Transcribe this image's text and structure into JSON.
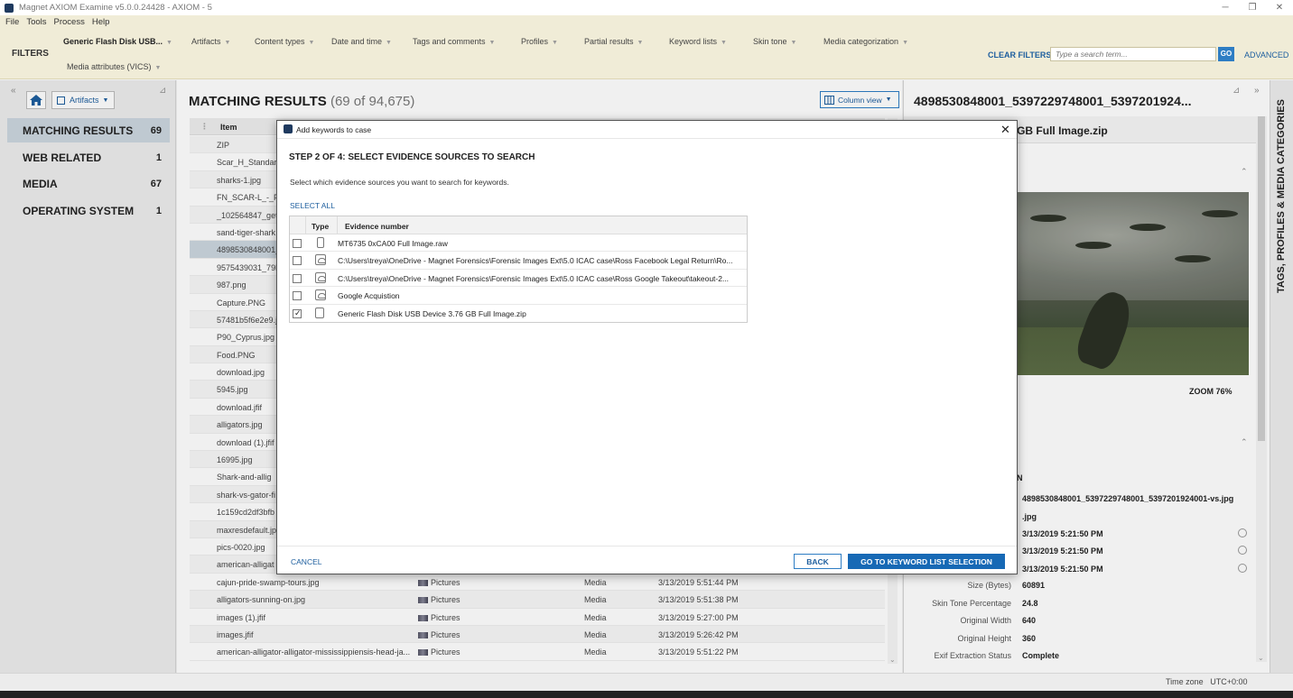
{
  "window": {
    "title": "Magnet AXIOM Examine v5.0.0.24428 - AXIOM - 5",
    "minimize": "─",
    "restore": "❐",
    "close": "✕"
  },
  "menu": [
    "File",
    "Tools",
    "Process",
    "Help"
  ],
  "filters": {
    "label": "FILTERS",
    "items": [
      "Generic Flash Disk USB...",
      "Artifacts",
      "Content types",
      "Date and time",
      "Tags and comments",
      "Profiles",
      "Partial results",
      "Keyword lists",
      "Skin tone",
      "Media categorization"
    ],
    "row2": "Media attributes (VICS)",
    "clear": "CLEAR FILTERS",
    "search_placeholder": "Type a search term...",
    "go": "GO",
    "advanced": "ADVANCED"
  },
  "left": {
    "collapse": "«",
    "pin": "⊿",
    "artifacts_button": "Artifacts",
    "nav": [
      {
        "label": "MATCHING RESULTS",
        "count": "69"
      },
      {
        "label": "WEB RELATED",
        "count": "1"
      },
      {
        "label": "MEDIA",
        "count": "67"
      },
      {
        "label": "OPERATING SYSTEM",
        "count": "1"
      }
    ]
  },
  "center": {
    "title": "MATCHING RESULTS",
    "count": "(69 of 94,675)",
    "column_view": "Column view",
    "header_item": "Item",
    "rows": [
      {
        "name": "ZIP"
      },
      {
        "name": "Scar_H_Standard"
      },
      {
        "name": "sharks-1.jpg"
      },
      {
        "name": "FN_SCAR-L_-_FN"
      },
      {
        "name": "_102564847_gett"
      },
      {
        "name": "sand-tiger-shark"
      },
      {
        "name": "4898530848001_"
      },
      {
        "name": "9575439031_79b"
      },
      {
        "name": "987.png"
      },
      {
        "name": "Capture.PNG"
      },
      {
        "name": "57481b5f6e2e9.j"
      },
      {
        "name": "P90_Cyprus.jpg"
      },
      {
        "name": "Food.PNG"
      },
      {
        "name": "download.jpg"
      },
      {
        "name": "5945.jpg"
      },
      {
        "name": "download.jfif"
      },
      {
        "name": "alligators.jpg"
      },
      {
        "name": "download (1).jfif"
      },
      {
        "name": "16995.jpg"
      },
      {
        "name": "Shark-and-allig"
      },
      {
        "name": "shark-vs-gator-fi"
      },
      {
        "name": "1c159cd2df3bfb"
      },
      {
        "name": "maxresdefault.jp"
      },
      {
        "name": "pics-0020.jpg"
      },
      {
        "name": "american-alligat"
      },
      {
        "name": "cajun-pride-swamp-tours.jpg",
        "cat": "Pictures",
        "type": "Media",
        "date": "3/13/2019 5:51:44 PM"
      },
      {
        "name": "alligators-sunning-on.jpg",
        "cat": "Pictures",
        "type": "Media",
        "date": "3/13/2019 5:51:38 PM"
      },
      {
        "name": "images (1).jfif",
        "cat": "Pictures",
        "type": "Media",
        "date": "3/13/2019 5:27:00 PM"
      },
      {
        "name": "images.jfif",
        "cat": "Pictures",
        "type": "Media",
        "date": "3/13/2019 5:26:42 PM"
      },
      {
        "name": "american-alligator-alligator-mississippiensis-head-ja...",
        "cat": "Pictures",
        "type": "Media",
        "date": "3/13/2019 5:51:22 PM"
      }
    ]
  },
  "right": {
    "title": "4898530848001_5397229748001_5397201924...",
    "pin": "⊿",
    "collapse": "»",
    "sub": "sk USB Device 3.76 GB Full Image.zip",
    "zoom": "ZOOM 76%",
    "partial_label": "N",
    "values": [
      "4898530848001_5397229748001_5397201924001-vs.jpg",
      ".jpg",
      "3/13/2019 5:21:50 PM",
      "3/13/2019 5:21:50 PM",
      "3/13/2019 5:21:50 PM"
    ],
    "props": [
      {
        "k": "Size (Bytes)",
        "v": "60891"
      },
      {
        "k": "Skin Tone Percentage",
        "v": "24.8"
      },
      {
        "k": "Original Width",
        "v": "640"
      },
      {
        "k": "Original Height",
        "v": "360"
      },
      {
        "k": "Exif Extraction Status",
        "v": "Complete"
      }
    ]
  },
  "sidetab": "TAGS, PROFILES & MEDIA CATEGORIES",
  "status": {
    "timezone_label": "Time zone",
    "timezone_value": "UTC+0:00"
  },
  "modal": {
    "title": "Add keywords to case",
    "close": "✕",
    "step": "STEP 2 OF 4: SELECT EVIDENCE SOURCES TO SEARCH",
    "desc": "Select which evidence sources you want to search for keywords.",
    "select_all": "SELECT ALL",
    "col_type": "Type",
    "col_evidence": "Evidence number",
    "rows": [
      {
        "checked": false,
        "icon": "phone-icon",
        "text": "MT6735 0xCA00 Full Image.raw"
      },
      {
        "checked": false,
        "icon": "cloud-icon",
        "text": "C:\\Users\\treya\\OneDrive - Magnet Forensics\\Forensic Images Ext\\5.0 ICAC case\\Ross Facebook Legal Return\\Ro..."
      },
      {
        "checked": false,
        "icon": "cloud-icon",
        "text": "C:\\Users\\treya\\OneDrive - Magnet Forensics\\Forensic Images Ext\\5.0 ICAC case\\Ross Google Takeout\\takeout-2..."
      },
      {
        "checked": false,
        "icon": "cloud-icon",
        "text": "Google Acquistion"
      },
      {
        "checked": true,
        "icon": "drive-icon",
        "text": "Generic Flash Disk USB Device 3.76 GB Full Image.zip"
      }
    ],
    "cancel": "CANCEL",
    "back": "BACK",
    "next": "GO TO KEYWORD LIST SELECTION"
  }
}
